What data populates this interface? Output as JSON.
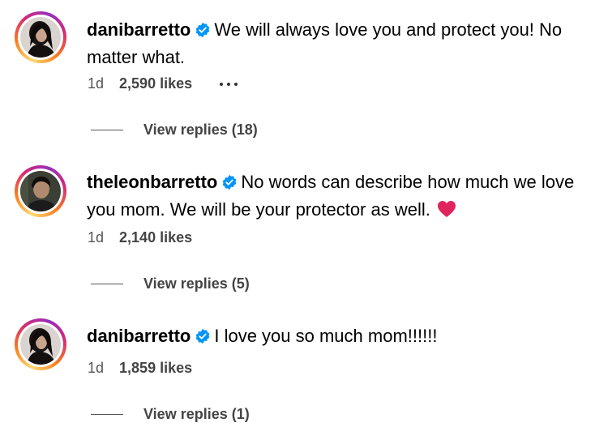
{
  "comments": [
    {
      "username": "danibarretto",
      "avatar_icon": "profile-photo-woman",
      "verified_icon": "verified-badge-icon",
      "text_line1": "We will always love you and protect you! No",
      "text_line2": "matter what.",
      "time": "1d",
      "likes": "2,590 likes",
      "more_icon": "more-options-icon",
      "replies": "View replies (18)"
    },
    {
      "username": "theleonbarretto",
      "avatar_icon": "profile-photo-man",
      "verified_icon": "verified-badge-icon",
      "text_line1": "No words can describe how much we love",
      "text_line2": "you mom. We will be your protector as well.",
      "emoji_icon": "red-heart-icon",
      "time": "1d",
      "likes": "2,140 likes",
      "replies": "View replies (5)"
    },
    {
      "username": "danibarretto",
      "avatar_icon": "profile-photo-woman",
      "verified_icon": "verified-badge-icon",
      "text_line1": "I love you so much mom!!!!!!",
      "time": "1d",
      "likes": "1,859 likes",
      "replies": "View replies (1)"
    }
  ],
  "colors": {
    "verified_blue": "#0095f6",
    "heart_red": "#e0245e",
    "meta_gray": "#555555"
  }
}
